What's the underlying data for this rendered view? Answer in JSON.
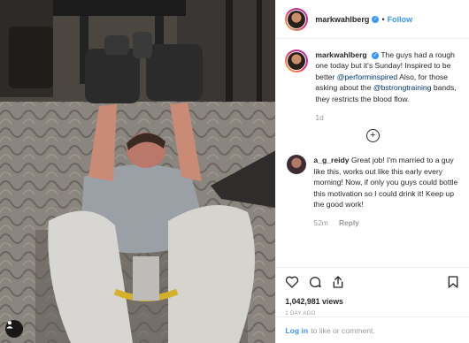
{
  "post": {
    "author": {
      "username": "markwahlberg",
      "verified": true,
      "follow_label": "Follow",
      "separator": "•"
    },
    "caption": {
      "username": "markwahlberg",
      "text_1": "The guys had a rough one today but it's Sunday! Inspired to be better ",
      "mention_1": "@performinspired",
      "text_2": " Also, for those asking about the ",
      "mention_2": "@bstrongtraining",
      "text_3": " bands, they restricts the blood flow.",
      "age": "1d"
    },
    "comments": [
      {
        "username": "a_g_reidy",
        "text": "Great job! I'm married to a guy like this, works out like this early every morning! Now, if only you guys could bottle this motivation so I could drink it! Keep up the good work!",
        "age": "52m",
        "reply_label": "Reply"
      }
    ],
    "load_more_label": "+",
    "stats": {
      "views": "1,042,981 views",
      "posted_ago": "1 DAY AGO"
    },
    "login": {
      "link_label": "Log in",
      "rest": "to like or comment."
    },
    "icons": {
      "like": "heart-icon",
      "comment": "comment-icon",
      "share": "share-icon",
      "save": "bookmark-icon",
      "tag": "user-tag-icon"
    },
    "colors": {
      "link_blue": "#3897f0",
      "mention_navy": "#003569",
      "muted_gray": "#999999",
      "text": "#262626"
    }
  }
}
